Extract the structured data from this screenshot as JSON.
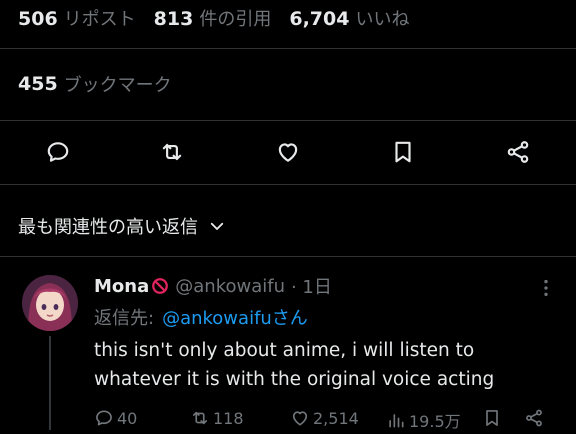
{
  "stats": [
    {
      "value": "506",
      "label": "リポスト"
    },
    {
      "value": "813",
      "label": "件の引用"
    },
    {
      "value": "6,704",
      "label": "いいね"
    }
  ],
  "bookmarks": {
    "value": "455",
    "label": "ブックマーク"
  },
  "actions": [
    {
      "icon": "reply-icon"
    },
    {
      "icon": "repost-icon"
    },
    {
      "icon": "like-icon"
    },
    {
      "icon": "bookmark-icon"
    },
    {
      "icon": "share-icon"
    }
  ],
  "sort": {
    "label": "最も関連性の高い返信"
  },
  "reply": {
    "name": "Mona",
    "handle": "@ankowaifu",
    "time": "· 1日",
    "reply_to_label": "返信先:",
    "reply_to_handle": "@ankowaifuさん",
    "text": "this isn't only about anime, i will listen to whatever it is with the original voice acting",
    "counts": {
      "replies": "40",
      "reposts": "118",
      "likes": "2,514",
      "views": "19.5万"
    }
  },
  "colors": {
    "background": "#000000",
    "text": "#e7e9ea",
    "muted": "#71767b",
    "link": "#1d9bf0",
    "divider": "#2f3336",
    "prohibited_emoji": "#e0245e"
  }
}
